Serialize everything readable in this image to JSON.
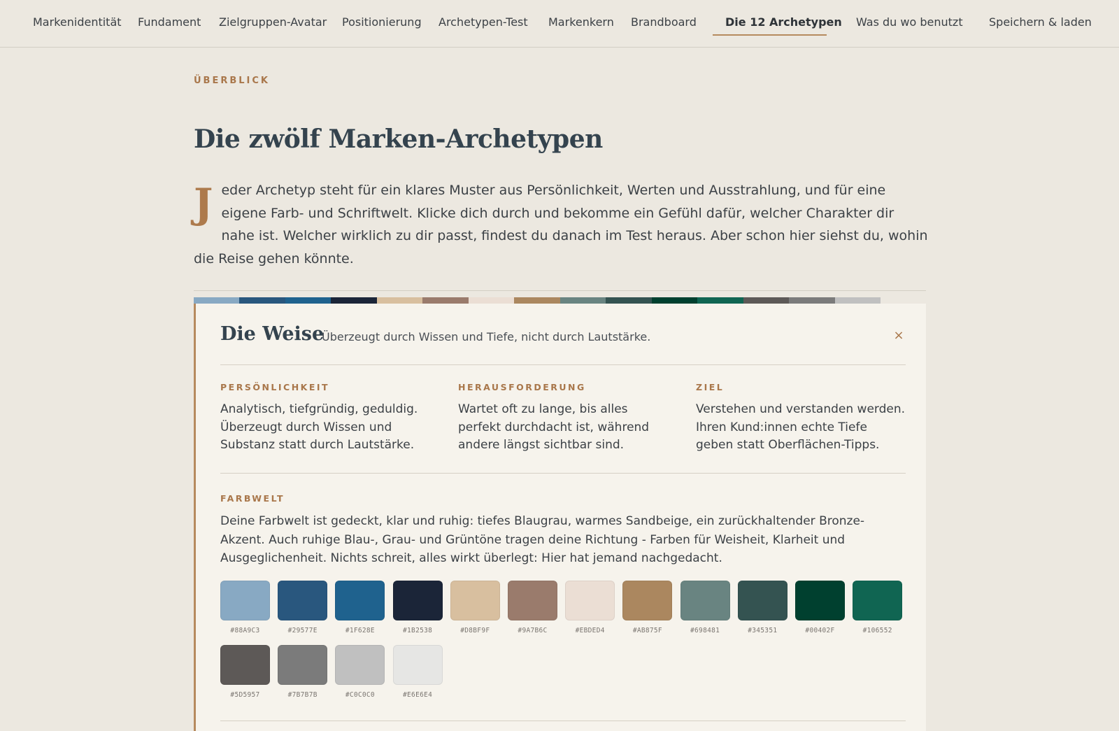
{
  "nav": {
    "items": [
      {
        "label": "Markenidentität"
      },
      {
        "label": "Fundament"
      },
      {
        "label": "Zielgruppen-Avatar"
      },
      {
        "label": "Positionierung"
      },
      {
        "label": "Archetypen-Test"
      },
      {
        "label": "Markenkern"
      },
      {
        "label": "Brandboard"
      },
      {
        "label": "Die 12 Archetypen",
        "active": true
      },
      {
        "label": "Was du wo benutzt"
      },
      {
        "label": "Speichern & laden"
      }
    ]
  },
  "header": {
    "eyebrow": "ÜBERBLICK",
    "title": "Die zwölf Marken-Archetypen",
    "intro_dropcap": "J",
    "intro_text": "eder Archetyp steht für ein klares Muster aus Persönlichkeit, Werten und Ausstrahlung, und für eine eigene Farb- und Schriftwelt. Klicke dich durch und bekomme ein Gefühl dafür, welcher Charakter dir nahe ist. Welcher wirklich zu dir passt, findest du danach im Test heraus. Aber schon hier siehst du, wohin die Reise gehen könnte."
  },
  "strip_colors": [
    "#88A9C3",
    "#29577E",
    "#1F628E",
    "#1B2538",
    "#D8BF9F",
    "#9A7B6C",
    "#EBDED4",
    "#AB875F",
    "#698481",
    "#345351",
    "#00402F",
    "#106552",
    "#5D5957",
    "#7B7B7B",
    "#C0C0C0"
  ],
  "card": {
    "title": "Die Weise",
    "tagline": "Überzeugt durch Wissen und Tiefe, nicht durch Lautstärke.",
    "close_icon": "×",
    "columns": [
      {
        "label": "PERSÖNLICHKEIT",
        "text": "Analytisch, tiefgründig, geduldig. Überzeugt durch Wissen und Substanz statt durch Lautstärke."
      },
      {
        "label": "HERAUSFORDERUNG",
        "text": "Wartet oft zu lange, bis alles perfekt durchdacht ist, während andere längst sichtbar sind."
      },
      {
        "label": "ZIEL",
        "text": "Verstehen und verstanden werden. Ihren Kund:innen echte Tiefe geben statt Oberflächen-Tipps."
      }
    ],
    "farbwelt": {
      "label": "FARBWELT",
      "text": "Deine Farbwelt ist gedeckt, klar und ruhig: tiefes Blaugrau, warmes Sandbeige, ein zurückhaltender Bronze-Akzent. Auch ruhige Blau-, Grau- und Grüntöne tragen deine Richtung - Farben für Weisheit, Klarheit und Ausgeglichenheit. Nichts schreit, alles wirkt überlegt: Hier hat jemand nachgedacht.",
      "swatches": [
        {
          "hex": "#88A9C3"
        },
        {
          "hex": "#29577E"
        },
        {
          "hex": "#1F628E"
        },
        {
          "hex": "#1B2538"
        },
        {
          "hex": "#D8BF9F"
        },
        {
          "hex": "#9A7B6C"
        },
        {
          "hex": "#EBDED4"
        },
        {
          "hex": "#AB875F"
        },
        {
          "hex": "#698481"
        },
        {
          "hex": "#345351"
        },
        {
          "hex": "#00402F"
        },
        {
          "hex": "#106552"
        },
        {
          "hex": "#5D5957"
        },
        {
          "hex": "#7B7B7B"
        },
        {
          "hex": "#C0C0C0"
        },
        {
          "hex": "#E6E6E4"
        }
      ]
    }
  },
  "colors": {
    "accent": "#B68A5E",
    "background": "#ECE8E0",
    "card_background": "#F6F3EC",
    "heading": "#34434E"
  }
}
